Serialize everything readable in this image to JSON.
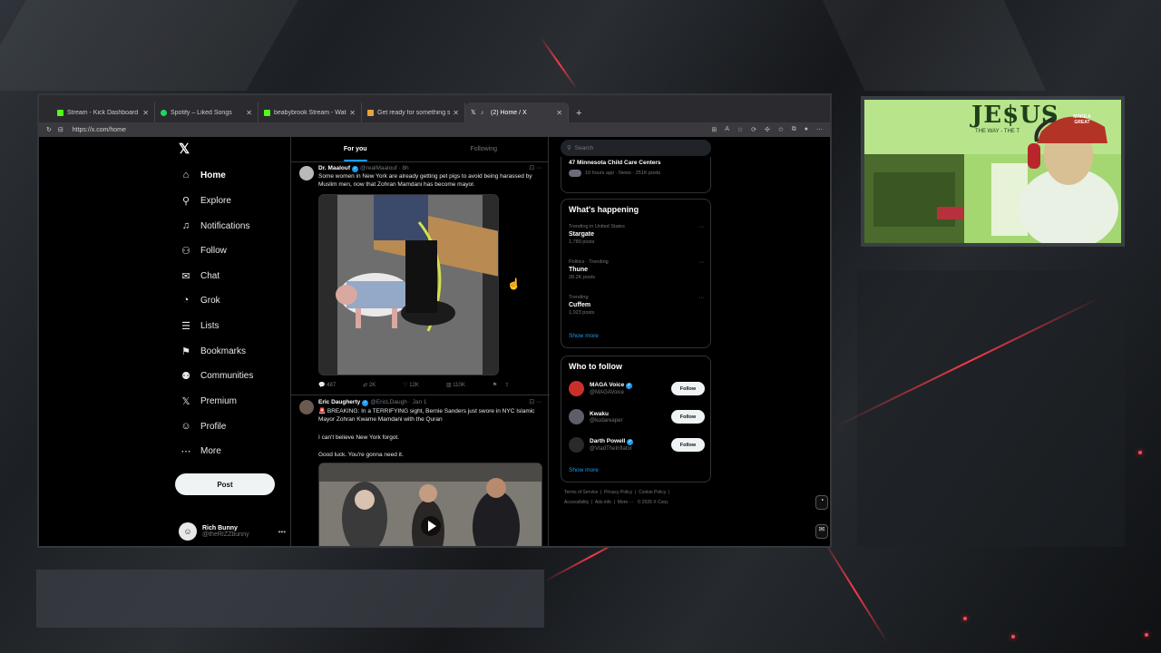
{
  "browser": {
    "tabs": [
      {
        "title": "Stream - Kick Dashboard",
        "color": "#53fc18"
      },
      {
        "title": "Spotify – Liked Songs",
        "color": "#1ed760"
      },
      {
        "title": "beabybrook Stream - Watch Live o",
        "color": "#53fc18"
      },
      {
        "title": "Get ready for something special #",
        "color": "#e8a33d"
      },
      {
        "title": "(2) Home / X",
        "color": "#ffffff",
        "active": true
      }
    ],
    "new_tab": "+",
    "url": "https://x.com/home"
  },
  "nav": {
    "logo": "𝕏",
    "items": [
      {
        "label": "Home",
        "icon": "⌂"
      },
      {
        "label": "Explore",
        "icon": "⚲"
      },
      {
        "label": "Notifications",
        "icon": "♫"
      },
      {
        "label": "Follow",
        "icon": "⚇"
      },
      {
        "label": "Chat",
        "icon": "✉"
      },
      {
        "label": "Grok",
        "icon": "◔"
      },
      {
        "label": "Lists",
        "icon": "☰"
      },
      {
        "label": "Bookmarks",
        "icon": "⚑"
      },
      {
        "label": "Communities",
        "icon": "⚉"
      },
      {
        "label": "Premium",
        "icon": "𝕏"
      },
      {
        "label": "Profile",
        "icon": "☺"
      },
      {
        "label": "More",
        "icon": "⋯"
      }
    ],
    "post_label": "Post",
    "account": {
      "name": "Rich Bunny",
      "handle": "@theRIZZbunny"
    }
  },
  "timeline": {
    "tabs": [
      "For you",
      "Following"
    ],
    "tweets": [
      {
        "name": "Dr. Maalouf",
        "meta": "@realMaalouf · 8h",
        "text": "Some women in New York are already getting pet pigs to avoid being harassed by Muslim men, now that Zohran Mamdani has become mayor.",
        "replies": "487",
        "reposts": "2K",
        "likes": "12K",
        "views": "110K"
      },
      {
        "name": "Eric Daugherty",
        "meta": "@EricLDaugh · Jan 1",
        "text": "🚨 BREAKING: In a TERRIFYING sight, Bernie Sanders just swore in NYC Islamic Mayor Zohran Kwame Mamdani with the Quran",
        "line2": "I can't believe New York forgot.",
        "line3": "Good luck. You're gonna need it."
      }
    ]
  },
  "right": {
    "search_placeholder": "Search",
    "top_item": {
      "title": "47 Minnesota Child Care Centers",
      "meta": "10 hours ago · News · 251K posts"
    },
    "whats_happening": {
      "title": "What's happening",
      "trends": [
        {
          "cat": "Trending in United States",
          "title": "Stargate",
          "count": "1,789 posts"
        },
        {
          "cat": "Politics · Trending",
          "title": "Thune",
          "count": "28.2K posts"
        },
        {
          "cat": "Trending",
          "title": "Cuffem",
          "count": "1,023 posts"
        }
      ],
      "show_more": "Show more"
    },
    "who_to_follow": {
      "title": "Who to follow",
      "users": [
        {
          "name": "MAGA Voice",
          "handle": "@MAGAVoice",
          "verified": true
        },
        {
          "name": "Kwaku",
          "handle": "@kudareaper",
          "verified": false
        },
        {
          "name": "Darth Powell",
          "handle": "@VladTheInflator",
          "verified": true
        }
      ],
      "follow_label": "Follow",
      "show_more": "Show more"
    },
    "footer": {
      "links": [
        "Terms of Service",
        "Privacy Policy",
        "Cookie Policy",
        "Accessibility",
        "Ads info",
        "More ···",
        "© 2026 X Corp."
      ]
    }
  },
  "overlay": {
    "cam_sign": "JE$US",
    "cam_sign_sub": "THE WAY - THE T",
    "hat_text": "MAKE A GREAT"
  }
}
